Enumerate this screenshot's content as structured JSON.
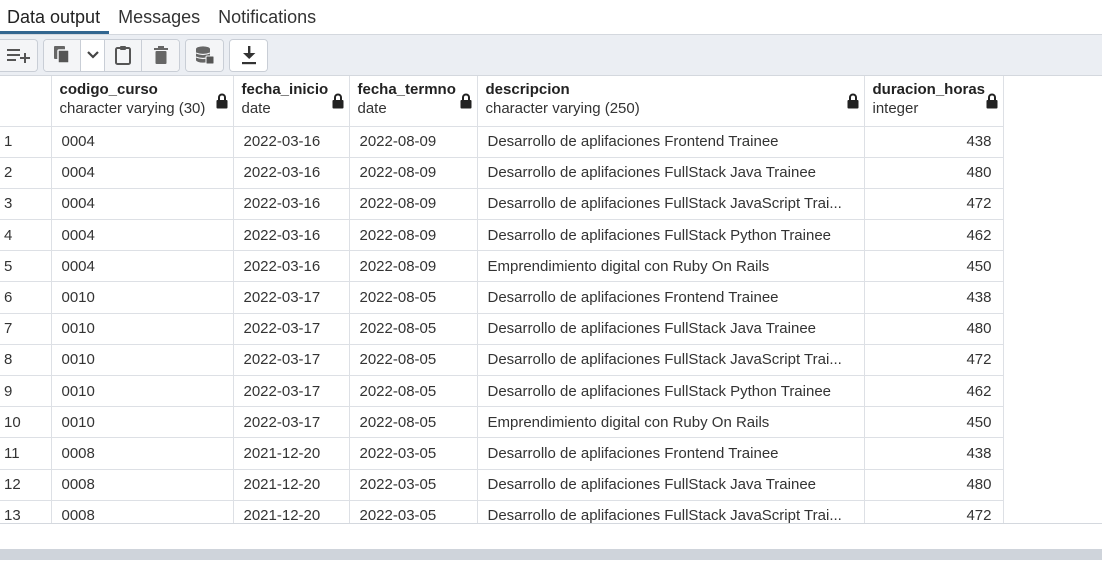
{
  "tabs": [
    {
      "label": "Data output",
      "active": true
    },
    {
      "label": "Messages",
      "active": false
    },
    {
      "label": "Notifications",
      "active": false
    }
  ],
  "toolbar": {
    "buttons": [
      {
        "icon": "add-row-icon"
      },
      {
        "icon": "copy-icon"
      },
      {
        "icon": "chevron-down-icon"
      },
      {
        "icon": "paste-icon"
      },
      {
        "icon": "delete-icon"
      },
      {
        "icon": "save-data-icon"
      },
      {
        "icon": "download-icon"
      }
    ]
  },
  "columns": [
    {
      "name": "codigo_curso",
      "type": "character varying (30)"
    },
    {
      "name": "fecha_inicio",
      "type": "date"
    },
    {
      "name": "fecha_termno",
      "type": "date"
    },
    {
      "name": "descripcion",
      "type": "character varying (250)"
    },
    {
      "name": "duracion_horas",
      "type": "integer"
    }
  ],
  "rows": [
    {
      "n": "1",
      "codigo_curso": "0004",
      "fecha_inicio": "2022-03-16",
      "fecha_termno": "2022-08-09",
      "descripcion": "Desarrollo de aplifaciones Frontend Trainee",
      "duracion_horas": "438"
    },
    {
      "n": "2",
      "codigo_curso": "0004",
      "fecha_inicio": "2022-03-16",
      "fecha_termno": "2022-08-09",
      "descripcion": "Desarrollo de aplifaciones FullStack Java Trainee",
      "duracion_horas": "480"
    },
    {
      "n": "3",
      "codigo_curso": "0004",
      "fecha_inicio": "2022-03-16",
      "fecha_termno": "2022-08-09",
      "descripcion": "Desarrollo de aplifaciones FullStack JavaScript Trai...",
      "duracion_horas": "472"
    },
    {
      "n": "4",
      "codigo_curso": "0004",
      "fecha_inicio": "2022-03-16",
      "fecha_termno": "2022-08-09",
      "descripcion": "Desarrollo de aplifaciones FullStack Python Trainee",
      "duracion_horas": "462"
    },
    {
      "n": "5",
      "codigo_curso": "0004",
      "fecha_inicio": "2022-03-16",
      "fecha_termno": "2022-08-09",
      "descripcion": "Emprendimiento digital con Ruby On Rails",
      "duracion_horas": "450"
    },
    {
      "n": "6",
      "codigo_curso": "0010",
      "fecha_inicio": "2022-03-17",
      "fecha_termno": "2022-08-05",
      "descripcion": "Desarrollo de aplifaciones Frontend Trainee",
      "duracion_horas": "438"
    },
    {
      "n": "7",
      "codigo_curso": "0010",
      "fecha_inicio": "2022-03-17",
      "fecha_termno": "2022-08-05",
      "descripcion": "Desarrollo de aplifaciones FullStack Java Trainee",
      "duracion_horas": "480"
    },
    {
      "n": "8",
      "codigo_curso": "0010",
      "fecha_inicio": "2022-03-17",
      "fecha_termno": "2022-08-05",
      "descripcion": "Desarrollo de aplifaciones FullStack JavaScript Trai...",
      "duracion_horas": "472"
    },
    {
      "n": "9",
      "codigo_curso": "0010",
      "fecha_inicio": "2022-03-17",
      "fecha_termno": "2022-08-05",
      "descripcion": "Desarrollo de aplifaciones FullStack Python Trainee",
      "duracion_horas": "462"
    },
    {
      "n": "10",
      "codigo_curso": "0010",
      "fecha_inicio": "2022-03-17",
      "fecha_termno": "2022-08-05",
      "descripcion": "Emprendimiento digital con Ruby On Rails",
      "duracion_horas": "450"
    },
    {
      "n": "11",
      "codigo_curso": "0008",
      "fecha_inicio": "2021-12-20",
      "fecha_termno": "2022-03-05",
      "descripcion": "Desarrollo de aplifaciones Frontend Trainee",
      "duracion_horas": "438"
    },
    {
      "n": "12",
      "codigo_curso": "0008",
      "fecha_inicio": "2021-12-20",
      "fecha_termno": "2022-03-05",
      "descripcion": "Desarrollo de aplifaciones FullStack Java Trainee",
      "duracion_horas": "480"
    },
    {
      "n": "13",
      "codigo_curso": "0008",
      "fecha_inicio": "2021-12-20",
      "fecha_termno": "2022-03-05",
      "descripcion": "Desarrollo de aplifaciones FullStack JavaScript Trai...",
      "duracion_horas": "472"
    }
  ],
  "colors": {
    "accent": "#326690",
    "toolbar_bg": "#ebeef3",
    "grid_line": "#dde0e5"
  }
}
